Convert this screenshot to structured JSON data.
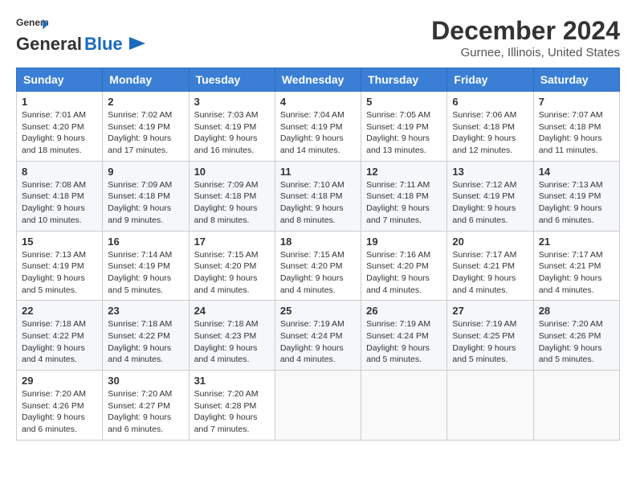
{
  "header": {
    "logo_line1": "General",
    "logo_line2": "Blue",
    "month_title": "December 2024",
    "location": "Gurnee, Illinois, United States"
  },
  "days_of_week": [
    "Sunday",
    "Monday",
    "Tuesday",
    "Wednesday",
    "Thursday",
    "Friday",
    "Saturday"
  ],
  "weeks": [
    [
      {
        "day": 1,
        "sunrise": "7:01 AM",
        "sunset": "4:20 PM",
        "daylight": "9 hours and 18 minutes."
      },
      {
        "day": 2,
        "sunrise": "7:02 AM",
        "sunset": "4:19 PM",
        "daylight": "9 hours and 17 minutes."
      },
      {
        "day": 3,
        "sunrise": "7:03 AM",
        "sunset": "4:19 PM",
        "daylight": "9 hours and 16 minutes."
      },
      {
        "day": 4,
        "sunrise": "7:04 AM",
        "sunset": "4:19 PM",
        "daylight": "9 hours and 14 minutes."
      },
      {
        "day": 5,
        "sunrise": "7:05 AM",
        "sunset": "4:19 PM",
        "daylight": "9 hours and 13 minutes."
      },
      {
        "day": 6,
        "sunrise": "7:06 AM",
        "sunset": "4:18 PM",
        "daylight": "9 hours and 12 minutes."
      },
      {
        "day": 7,
        "sunrise": "7:07 AM",
        "sunset": "4:18 PM",
        "daylight": "9 hours and 11 minutes."
      }
    ],
    [
      {
        "day": 8,
        "sunrise": "7:08 AM",
        "sunset": "4:18 PM",
        "daylight": "9 hours and 10 minutes."
      },
      {
        "day": 9,
        "sunrise": "7:09 AM",
        "sunset": "4:18 PM",
        "daylight": "9 hours and 9 minutes."
      },
      {
        "day": 10,
        "sunrise": "7:09 AM",
        "sunset": "4:18 PM",
        "daylight": "9 hours and 8 minutes."
      },
      {
        "day": 11,
        "sunrise": "7:10 AM",
        "sunset": "4:18 PM",
        "daylight": "9 hours and 8 minutes."
      },
      {
        "day": 12,
        "sunrise": "7:11 AM",
        "sunset": "4:18 PM",
        "daylight": "9 hours and 7 minutes."
      },
      {
        "day": 13,
        "sunrise": "7:12 AM",
        "sunset": "4:19 PM",
        "daylight": "9 hours and 6 minutes."
      },
      {
        "day": 14,
        "sunrise": "7:13 AM",
        "sunset": "4:19 PM",
        "daylight": "9 hours and 6 minutes."
      }
    ],
    [
      {
        "day": 15,
        "sunrise": "7:13 AM",
        "sunset": "4:19 PM",
        "daylight": "9 hours and 5 minutes."
      },
      {
        "day": 16,
        "sunrise": "7:14 AM",
        "sunset": "4:19 PM",
        "daylight": "9 hours and 5 minutes."
      },
      {
        "day": 17,
        "sunrise": "7:15 AM",
        "sunset": "4:20 PM",
        "daylight": "9 hours and 4 minutes."
      },
      {
        "day": 18,
        "sunrise": "7:15 AM",
        "sunset": "4:20 PM",
        "daylight": "9 hours and 4 minutes."
      },
      {
        "day": 19,
        "sunrise": "7:16 AM",
        "sunset": "4:20 PM",
        "daylight": "9 hours and 4 minutes."
      },
      {
        "day": 20,
        "sunrise": "7:17 AM",
        "sunset": "4:21 PM",
        "daylight": "9 hours and 4 minutes."
      },
      {
        "day": 21,
        "sunrise": "7:17 AM",
        "sunset": "4:21 PM",
        "daylight": "9 hours and 4 minutes."
      }
    ],
    [
      {
        "day": 22,
        "sunrise": "7:18 AM",
        "sunset": "4:22 PM",
        "daylight": "9 hours and 4 minutes."
      },
      {
        "day": 23,
        "sunrise": "7:18 AM",
        "sunset": "4:22 PM",
        "daylight": "9 hours and 4 minutes."
      },
      {
        "day": 24,
        "sunrise": "7:18 AM",
        "sunset": "4:23 PM",
        "daylight": "9 hours and 4 minutes."
      },
      {
        "day": 25,
        "sunrise": "7:19 AM",
        "sunset": "4:24 PM",
        "daylight": "9 hours and 4 minutes."
      },
      {
        "day": 26,
        "sunrise": "7:19 AM",
        "sunset": "4:24 PM",
        "daylight": "9 hours and 5 minutes."
      },
      {
        "day": 27,
        "sunrise": "7:19 AM",
        "sunset": "4:25 PM",
        "daylight": "9 hours and 5 minutes."
      },
      {
        "day": 28,
        "sunrise": "7:20 AM",
        "sunset": "4:26 PM",
        "daylight": "9 hours and 5 minutes."
      }
    ],
    [
      {
        "day": 29,
        "sunrise": "7:20 AM",
        "sunset": "4:26 PM",
        "daylight": "9 hours and 6 minutes."
      },
      {
        "day": 30,
        "sunrise": "7:20 AM",
        "sunset": "4:27 PM",
        "daylight": "9 hours and 6 minutes."
      },
      {
        "day": 31,
        "sunrise": "7:20 AM",
        "sunset": "4:28 PM",
        "daylight": "9 hours and 7 minutes."
      },
      null,
      null,
      null,
      null
    ]
  ],
  "labels": {
    "sunrise": "Sunrise:",
    "sunset": "Sunset:",
    "daylight": "Daylight:"
  }
}
